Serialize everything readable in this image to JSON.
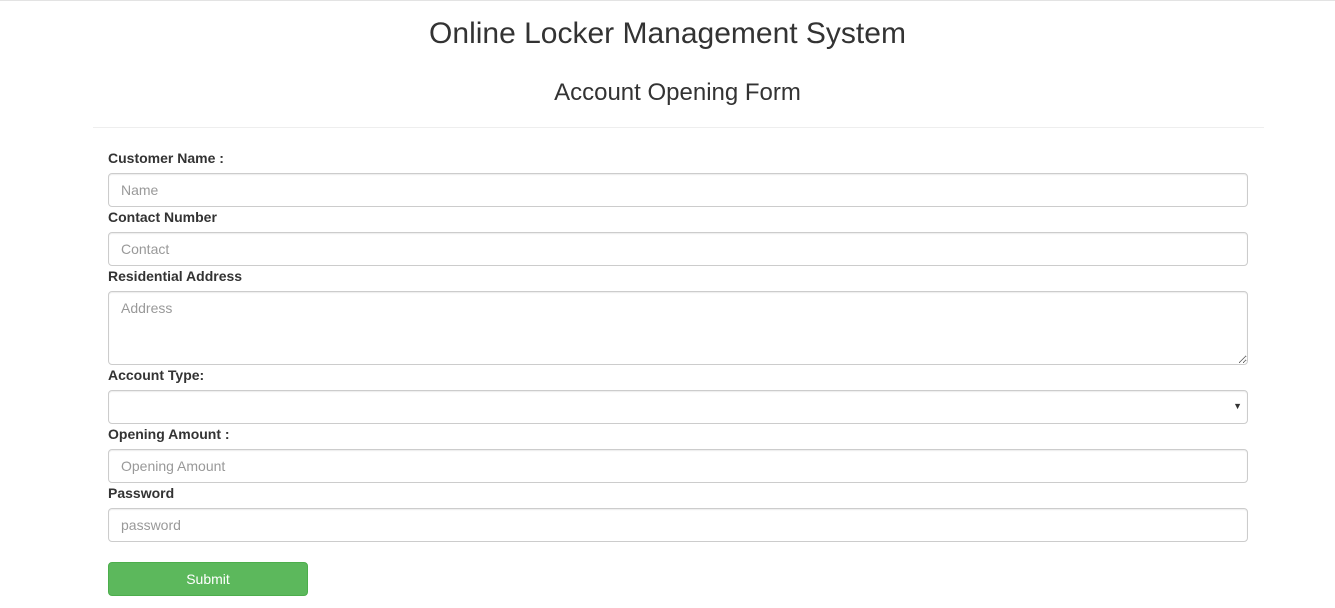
{
  "header": {
    "app_title": "Online Locker Management System",
    "form_title": "Account Opening Form"
  },
  "form": {
    "customer_name": {
      "label": "Customer Name :",
      "placeholder": "Name",
      "value": ""
    },
    "contact_number": {
      "label": "Contact Number",
      "placeholder": "Contact",
      "value": ""
    },
    "residential_address": {
      "label": "Residential Address",
      "placeholder": "Address",
      "value": ""
    },
    "account_type": {
      "label": "Account Type:",
      "selected": ""
    },
    "opening_amount": {
      "label": "Opening Amount :",
      "placeholder": "Opening Amount",
      "value": ""
    },
    "password": {
      "label": "Password",
      "placeholder": "password",
      "value": ""
    },
    "submit_label": "Submit"
  },
  "icons": {
    "select_arrow": "chevron-down-icon"
  },
  "colors": {
    "submit_background": "#5cb85c",
    "submit_border": "#4cae4c",
    "input_border": "#cccccc",
    "text": "#333333",
    "placeholder": "#999999"
  }
}
